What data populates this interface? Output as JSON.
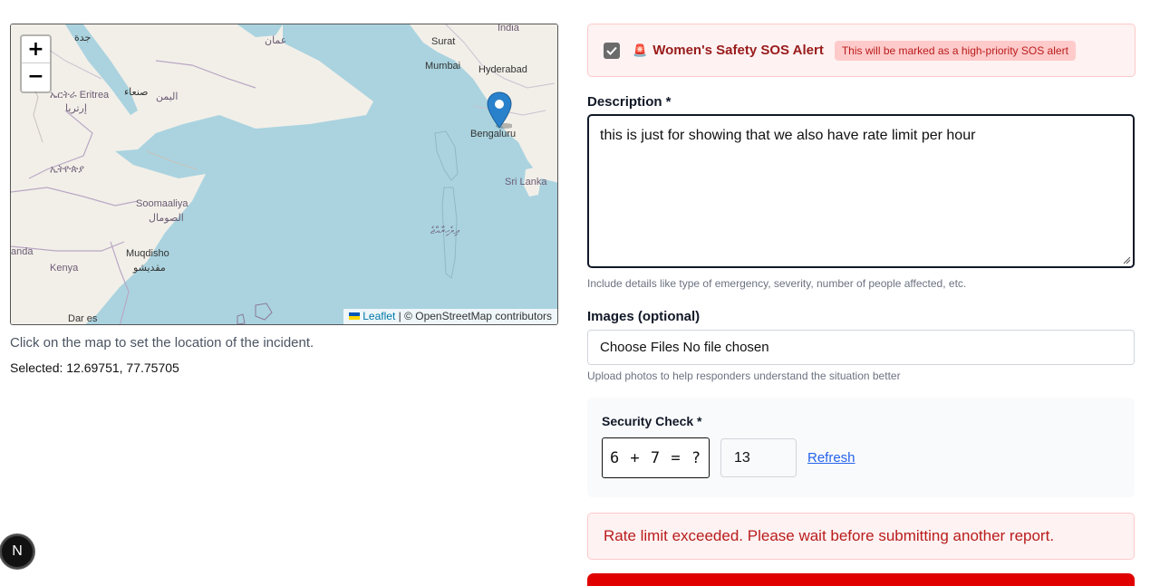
{
  "map": {
    "zoom_in": "+",
    "zoom_out": "−",
    "attribution_link": "Leaflet",
    "attribution_text": " | © OpenStreetMap contributors",
    "labels": {
      "india": "India",
      "jeddah": "جدة",
      "oman": "عمان",
      "surat": "Surat",
      "mumbai": "Mumbai",
      "hyderabad": "Hyderabad",
      "bengaluru": "Bengaluru",
      "sri_lanka": "Sri Lanka",
      "eritrea": "ኤርትራ Eritrea",
      "eritrea_ar": "إرتريا",
      "sanaa": "صنعاء",
      "yemen": "اليمن",
      "ethiopia": "ኢትዮጵያ",
      "somalia": "Soomaaliya",
      "somalia_ar": "الصومال",
      "maldives": "ދިވެހިރާއްޖެ",
      "uganda": "anda",
      "kenya": "Kenya",
      "mogadishu": "Muqdisho",
      "mogadishu_ar": "مقديشو",
      "dar": "Dar es"
    },
    "colors": {
      "water": "#aad3df",
      "land": "#f2efe9",
      "border": "#b9a8c4"
    }
  },
  "map_help": "Click on the map to set the location of the incident.",
  "selected": "Selected: 12.69751, 77.75705",
  "sos": {
    "checked": true,
    "icon": "siren-icon",
    "icon_glyph": "🚨",
    "title": "Women's Safety SOS Alert",
    "badge": "This will be marked as a high-priority SOS alert"
  },
  "description": {
    "label": "Description *",
    "value": "this is just for showing that we also have rate limit per hour",
    "hint": "Include details like type of emergency, severity, number of people affected, etc."
  },
  "images": {
    "label": "Images (optional)",
    "button": "Choose Files",
    "status": "No file chosen",
    "hint": "Upload photos to help responders understand the situation better"
  },
  "security": {
    "label": "Security Check *",
    "question": "6 + 7 = ?",
    "answer": "13",
    "refresh": "Refresh"
  },
  "error": "Rate limit exceeded. Please wait before submitting another report.",
  "next_badge": "N",
  "colors": {
    "accent_red": "#e00000",
    "link_blue": "#2563eb",
    "error_text": "#b91c1c"
  }
}
